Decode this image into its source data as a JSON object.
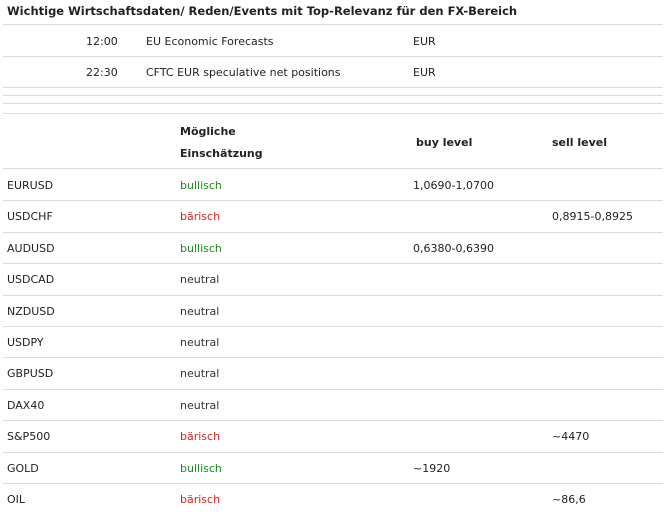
{
  "heading": "Wichtige Wirtschaftsdaten/ Reden/Events mit Top-Relevanz für den FX-Bereich",
  "events": [
    {
      "time": "12:00",
      "name": "EU Economic Forecasts",
      "currency": "EUR"
    },
    {
      "time": "22:30",
      "name": "CFTC EUR speculative net positions",
      "currency": "EUR"
    }
  ],
  "table": {
    "headers": {
      "assessment_line1": "Mögliche",
      "assessment_line2": "Einschätzung",
      "buy": "buy level",
      "sell": "sell level"
    },
    "rows": [
      {
        "pair": "EURUSD",
        "sentiment": "bullisch",
        "type": "bull",
        "buy": "1,0690-1,0700",
        "sell": ""
      },
      {
        "pair": "USDCHF",
        "sentiment": "bärisch",
        "type": "bear",
        "buy": "",
        "sell": "0,8915-0,8925"
      },
      {
        "pair": "AUDUSD",
        "sentiment": "bullisch",
        "type": "bull",
        "buy": "0,6380-0,6390",
        "sell": ""
      },
      {
        "pair": "USDCAD",
        "sentiment": "neutral",
        "type": "neut",
        "buy": "",
        "sell": ""
      },
      {
        "pair": "NZDUSD",
        "sentiment": "neutral",
        "type": "neut",
        "buy": "",
        "sell": ""
      },
      {
        "pair": "USDPY",
        "sentiment": "neutral",
        "type": "neut",
        "buy": "",
        "sell": ""
      },
      {
        "pair": "GBPUSD",
        "sentiment": "neutral",
        "type": "neut",
        "buy": "",
        "sell": ""
      },
      {
        "pair": "DAX40",
        "sentiment": "neutral",
        "type": "neut",
        "buy": "",
        "sell": ""
      },
      {
        "pair": "S&P500",
        "sentiment": "bärisch",
        "type": "bear",
        "buy": "",
        "sell": "~4470"
      },
      {
        "pair": "GOLD",
        "sentiment": "bullisch",
        "type": "bull",
        "buy": "~1920",
        "sell": ""
      },
      {
        "pair": "OIL",
        "sentiment": "bärisch",
        "type": "bear",
        "buy": "",
        "sell": "~86,6"
      }
    ]
  },
  "colors": {
    "bullish": "#1a8a1a",
    "bearish": "#d62020",
    "neutral": "#333333",
    "divider": "#dcdcdc"
  }
}
